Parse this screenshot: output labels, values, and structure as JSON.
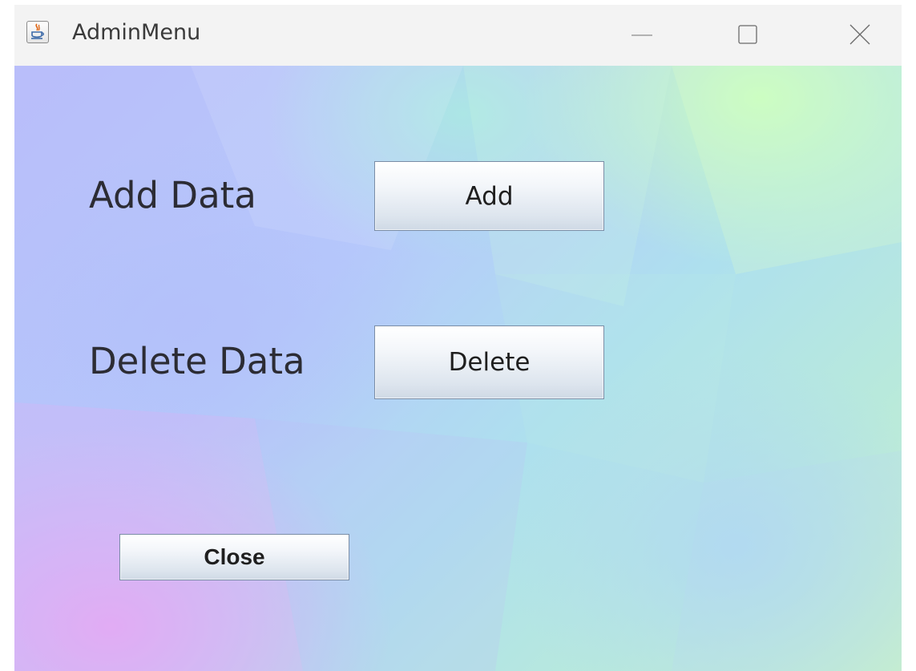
{
  "window": {
    "title": "AdminMenu",
    "icon": "java-cup-icon",
    "controls": {
      "minimize": "minimize-icon",
      "maximize": "maximize-icon",
      "close": "close-icon"
    }
  },
  "main": {
    "add_row": {
      "label": "Add Data",
      "button_label": "Add"
    },
    "delete_row": {
      "label": "Delete Data",
      "button_label": "Delete"
    },
    "close_button_label": "Close"
  },
  "colors": {
    "titlebar_bg": "#f3f3f3",
    "label_text": "#2c2c34",
    "button_border": "#7a8da6"
  }
}
